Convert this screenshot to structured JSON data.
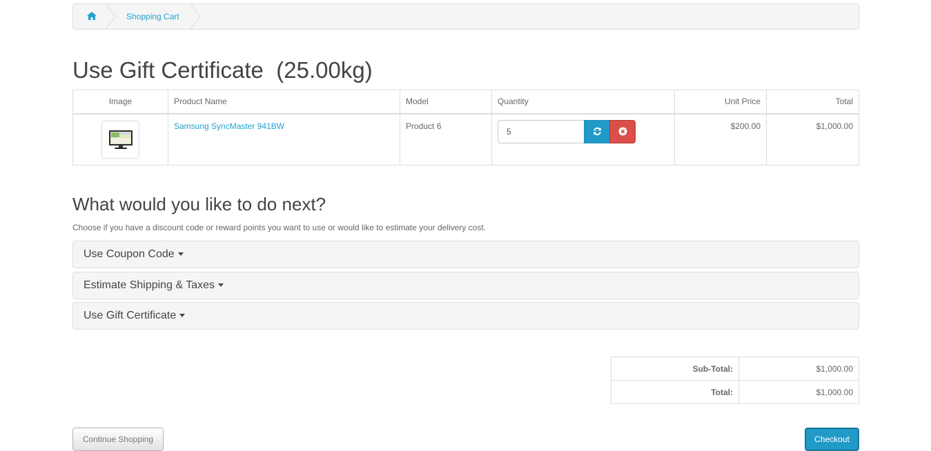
{
  "breadcrumb": {
    "home_icon": "home-icon",
    "items": [
      "Shopping Cart"
    ]
  },
  "page": {
    "title": "Use Gift Certificate",
    "weight": "(25.00kg)"
  },
  "cart": {
    "headers": [
      "Image",
      "Product Name",
      "Model",
      "Quantity",
      "Unit Price",
      "Total"
    ],
    "rows": [
      {
        "image_icon": "monitor-thumbnail",
        "name": "Samsung SyncMaster 941BW",
        "model": "Product 6",
        "quantity": "5",
        "unit_price": "$200.00",
        "total": "$1,000.00"
      }
    ],
    "update_icon": "refresh-icon",
    "remove_icon": "remove-circle-icon",
    "update_color": "#229ac8",
    "remove_color": "#da4f49"
  },
  "next": {
    "title": "What would you like to do next?",
    "description": "Choose if you have a discount code or reward points you want to use or would like to estimate your delivery cost.",
    "panels": [
      "Use Coupon Code",
      "Estimate Shipping & Taxes",
      "Use Gift Certificate"
    ]
  },
  "totals": [
    {
      "label": "Sub-Total:",
      "value": "$1,000.00"
    },
    {
      "label": "Total:",
      "value": "$1,000.00"
    }
  ],
  "buttons": {
    "continue": "Continue Shopping",
    "checkout": "Checkout"
  },
  "colors": {
    "link": "#23a1d1",
    "primary": "#229ac8"
  }
}
